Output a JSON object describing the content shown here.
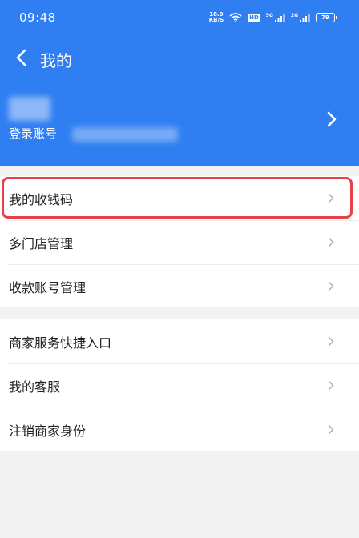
{
  "status_bar": {
    "time": "09:48",
    "net_speed_value": "18.0",
    "net_speed_unit": "KB/S",
    "hd_label": "HD",
    "signal_1_label": "5G",
    "signal_2_label": "2G",
    "battery_level": "79"
  },
  "header": {
    "title": "我的",
    "account_label": "登录账号"
  },
  "menu_group_1": [
    {
      "label": "我的收钱码"
    },
    {
      "label": "多门店管理"
    },
    {
      "label": "收款账号管理"
    }
  ],
  "menu_group_2": [
    {
      "label": "商家服务快捷入口"
    },
    {
      "label": "我的客服"
    },
    {
      "label": "注销商家身份"
    }
  ],
  "colors": {
    "header_bg": "#2f7ef2",
    "highlight": "#e8404a",
    "page_bg": "#f2f2f2"
  },
  "icons": {
    "back": "chevron-left-icon",
    "account_arrow": "chevron-right-icon",
    "menu_arrow": "chevron-right-icon",
    "wifi": "wifi-icon",
    "signal": "signal-icon",
    "battery": "battery-icon"
  }
}
